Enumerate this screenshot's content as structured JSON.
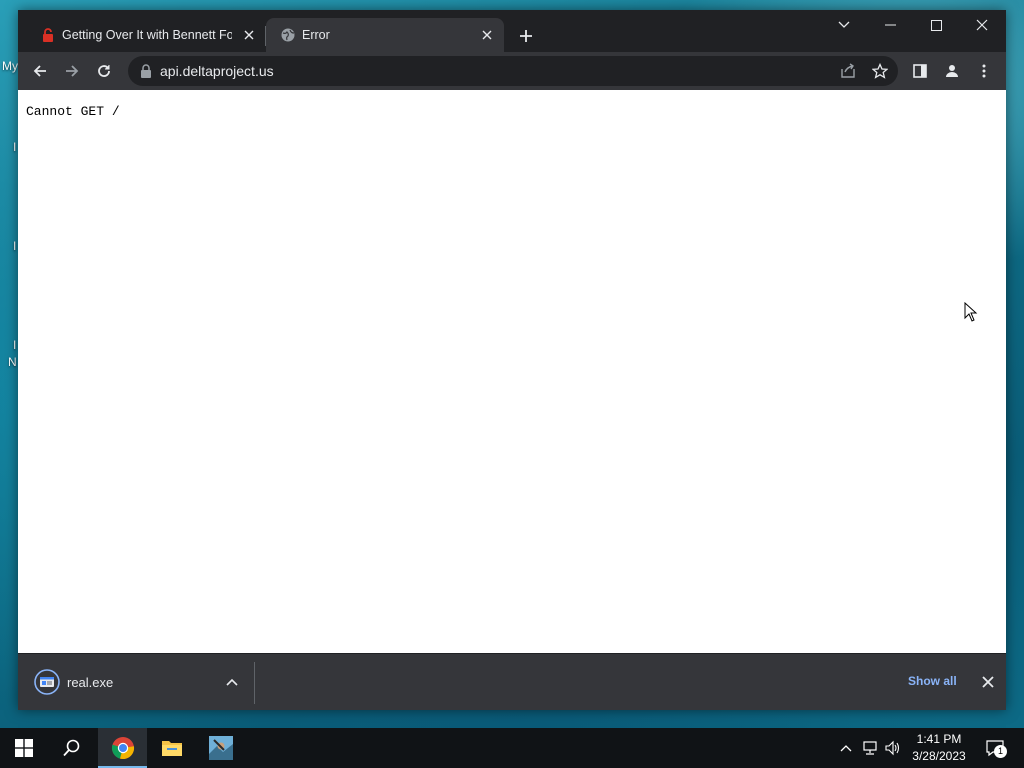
{
  "desktop": {
    "fragments": [
      "My",
      "I",
      "I",
      "I",
      "N"
    ]
  },
  "browser": {
    "tabs": [
      {
        "title": "Getting Over It with Bennett Foddy",
        "favicon": "red-lock-icon",
        "active": false
      },
      {
        "title": "Error",
        "favicon": "globe-icon",
        "active": true
      }
    ],
    "address_bar": {
      "url": "api.deltaproject.us"
    },
    "page": {
      "text": "Cannot GET /"
    },
    "download_shelf": {
      "file_name": "real.exe",
      "show_all_label": "Show all"
    },
    "colors": {
      "frame": "#202124",
      "toolbar": "#35363a",
      "link": "#8ab4f8"
    }
  },
  "taskbar": {
    "apps": [
      "windows-start-icon",
      "search-icon",
      "chrome-icon",
      "file-explorer-icon",
      "game-app-icon"
    ],
    "clock": {
      "time": "1:41 PM",
      "date": "3/28/2023"
    },
    "notification_count": "1"
  }
}
